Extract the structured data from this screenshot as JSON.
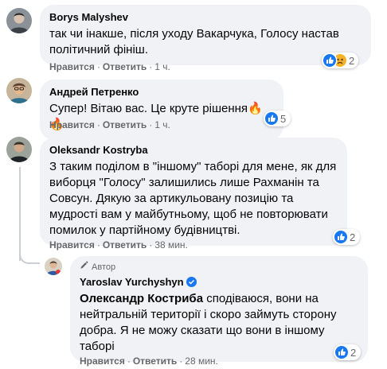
{
  "comments": [
    {
      "author": "Borys Malyshev",
      "text": "так чи інакше, після уходу Вакарчука, Голосу настав політичний фініш.",
      "like_label": "Нравится",
      "reply_label": "Ответить",
      "time": "1 ч.",
      "reaction_count": "2",
      "reactions": [
        "like-reaction",
        "sad-reaction"
      ]
    },
    {
      "author": "Андрей Петренко",
      "text": "Супер! Вітаю вас. Це круте рішення🔥🔥",
      "like_label": "Нравится",
      "reply_label": "Ответить",
      "time": "1 ч.",
      "reaction_count": "5",
      "reactions": [
        "like-reaction"
      ]
    },
    {
      "author": "Oleksandr Kostryba",
      "text": "З таким поділом в \"іншому\" таборі для мене, як для виборця \"Голосу\" залишились лише Рахманін та Совсун. Дякую за артикульовану позицію та мудрості вам у майбутньому, щоб не повторювати помилок у партійному будівництві.",
      "like_label": "Нравится",
      "reply_label": "Ответить",
      "time": "38 мин.",
      "reaction_count": "2",
      "reactions": [
        "like-reaction"
      ]
    }
  ],
  "reply": {
    "author_badge": "Автор",
    "author": "Yaroslav Yurchyshyn",
    "mention": "Олександр Костриба",
    "text": " сподіваюся, вони на нейтральній території і скоро займуть сторону добра. Я не можу сказати що вони в іншому таборі",
    "like_label": "Нравится",
    "reply_label": "Ответить",
    "time": "28 мин.",
    "reaction_count": "2",
    "reactions": [
      "like-reaction"
    ]
  },
  "separator": "·",
  "colors": {
    "bubble": "#f0f2f5",
    "meta": "#65676b",
    "like_blue": "#1877f2",
    "verified": "#1877f2"
  }
}
